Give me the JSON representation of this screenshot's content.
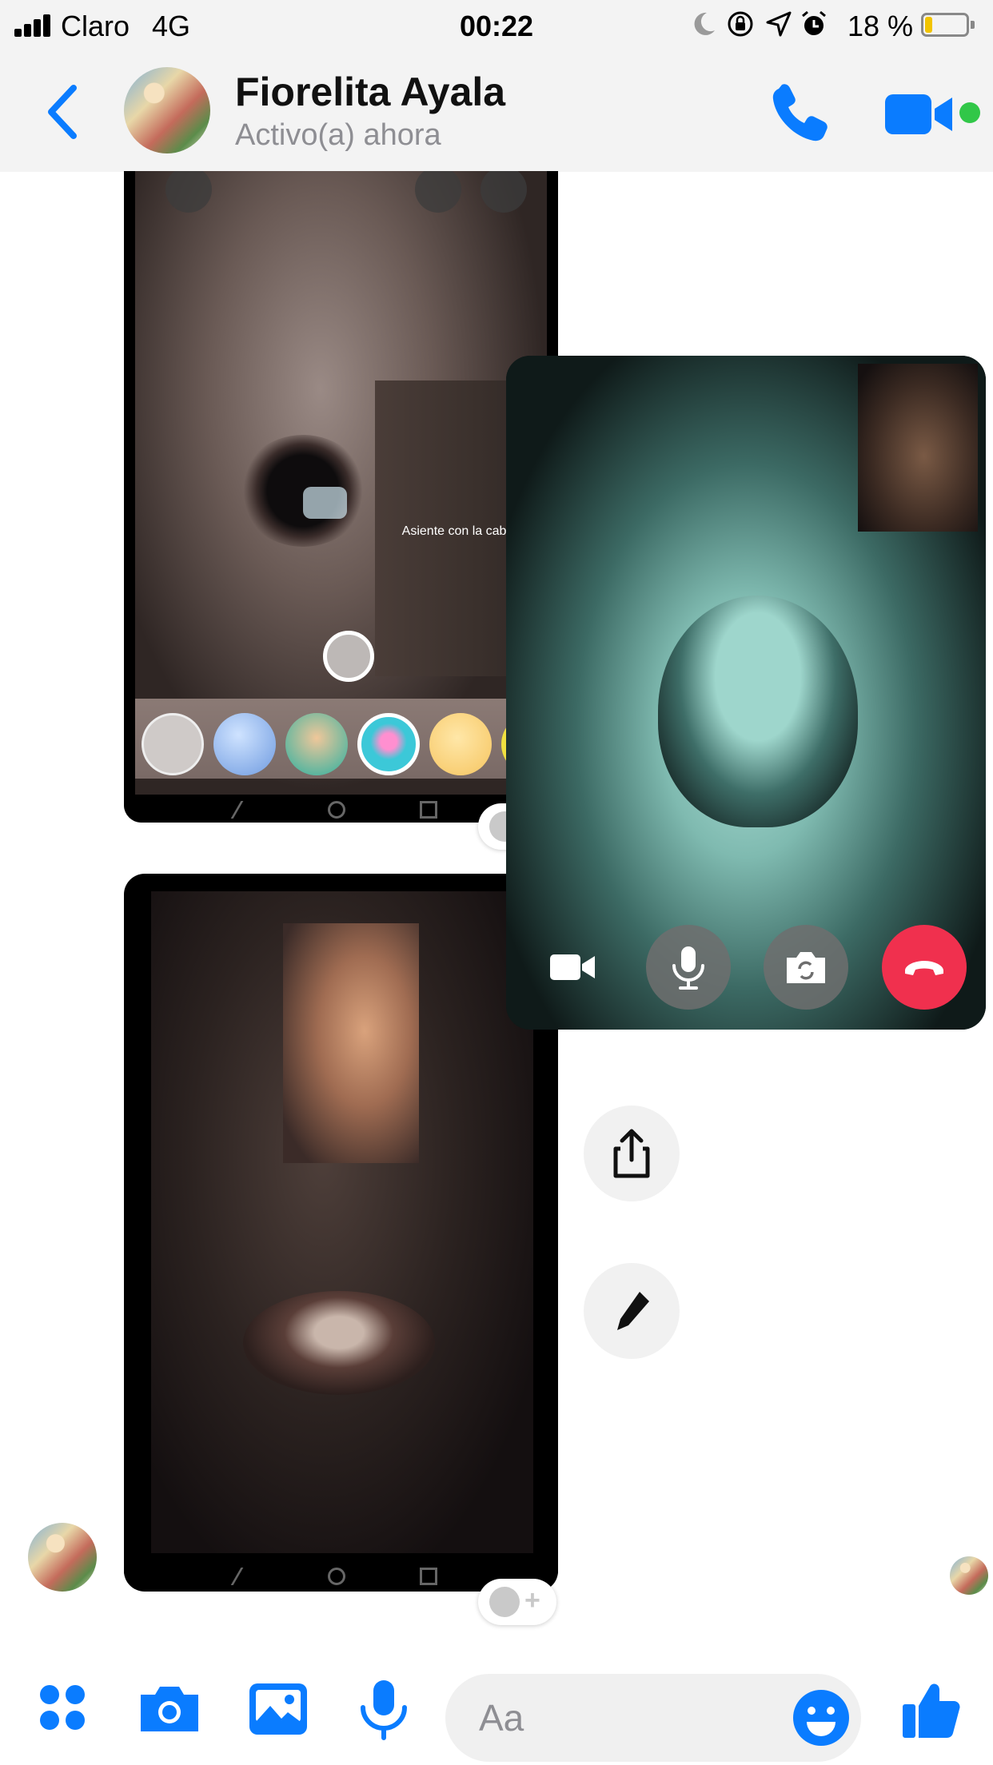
{
  "status_bar": {
    "carrier": "Claro",
    "network": "4G",
    "time": "00:22",
    "battery_percent": "18 %",
    "battery_level": 0.18,
    "icons": [
      "moon-icon",
      "rotation-lock-icon",
      "location-arrow-icon",
      "alarm-icon"
    ]
  },
  "header": {
    "contact_name": "Fiorelita Ayala",
    "contact_status": "Activo(a) ahora",
    "icons": [
      "back-chevron-icon",
      "phone-icon",
      "video-camera-icon"
    ],
    "accent_color": "#0a7cff",
    "online_color": "#31c748"
  },
  "thread": {
    "screenshot_1": {
      "overlay_text": "Asiente con la cabez",
      "filter_icons": [
        "none-filter-icon",
        "blue-filter-icon",
        "bear-glasses-filter-icon",
        "hearts-filter-icon",
        "yellow-filter-icon"
      ]
    },
    "side_actions": [
      "share-icon",
      "pencil-icon"
    ],
    "reaction_icon": "add-reaction-icon"
  },
  "call_overlay": {
    "controls": [
      "video-camera-icon",
      "microphone-icon",
      "switch-camera-icon",
      "end-call-icon"
    ],
    "end_call_color": "#f0304e"
  },
  "composer": {
    "placeholder": "Aa",
    "icons": [
      "apps-grid-icon",
      "camera-icon",
      "photo-icon",
      "microphone-icon",
      "emoji-icon",
      "thumbs-up-icon"
    ]
  }
}
